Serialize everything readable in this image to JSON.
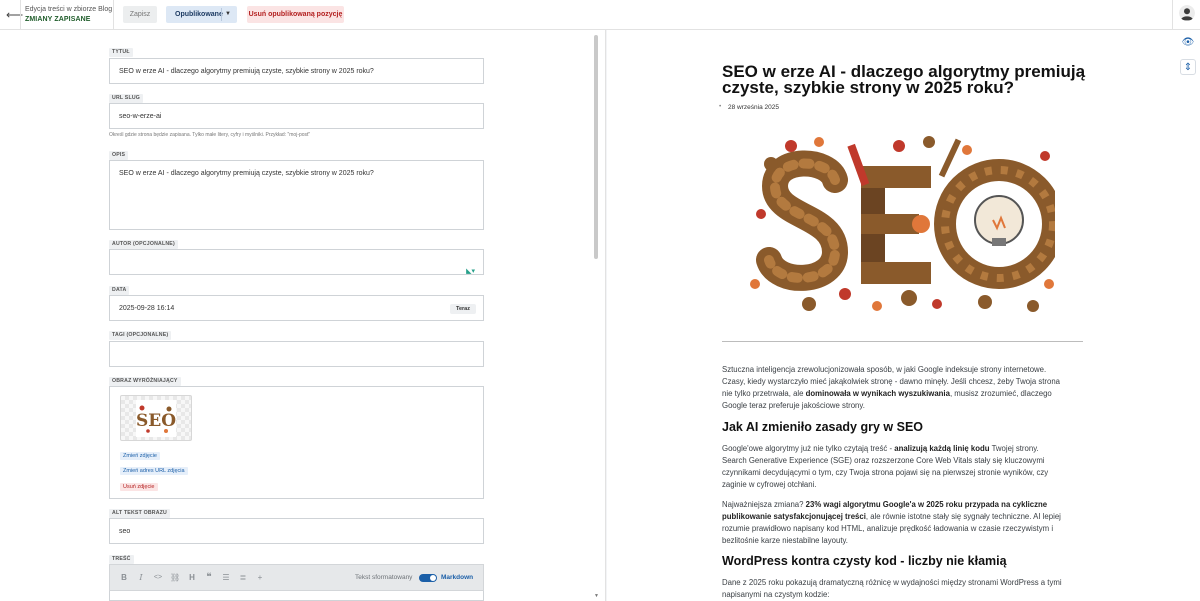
{
  "topbar": {
    "breadcrumb": "Edycja treści w zbiorze Blog",
    "status": "ZMIANY ZAPISANE",
    "save_label": "Zapisz",
    "publish_label": "Opublikowane",
    "unpublish_label": "Usuń opublikowaną pozycję"
  },
  "form": {
    "title_label": "TYTUŁ",
    "title_value": "SEO w erze AI - dlaczego algorytmy premiują czyste, szybkie strony w 2025 roku?",
    "slug_label": "URL SLUG",
    "slug_value": "seo-w-erze-ai",
    "slug_hint": "Określ gdzie strona będzie zapisana. Tylko małe litery, cyfry i myślniki. Przykład: \"moj-post\"",
    "desc_label": "OPIS",
    "desc_value": "SEO w erze AI - dlaczego algorytmy premiują czyste, szybkie strony w 2025 roku?",
    "author_label": "AUTOR (OPCJONALNE)",
    "date_label": "DATA",
    "date_value": "2025-09-28 16:14",
    "now_label": "Teraz",
    "tags_label": "TAGI (OPCJONALNE)",
    "image_label": "OBRAZ WYRÓŻNIAJĄCY",
    "change_image": "Zmień zdjęcie",
    "change_image_url": "Zmień adres URL zdjęcia",
    "remove_image": "Usuń zdjęcie",
    "alt_label": "ALT TEKST OBRAZU",
    "alt_value": "seo",
    "content_label": "TREŚĆ",
    "formatted_text_label": "Tekst sformatowany",
    "markdown_label": "Markdown"
  },
  "preview": {
    "title": "SEO w erze AI - dlaczego algorytmy premiują czyste, szybkie strony w 2025 roku?",
    "date": "28 września 2025",
    "p1_a": "Sztuczna inteligencja zrewolucjonizowała sposób, w jaki Google indeksuje strony internetowe. Czasy, kiedy wystarczyło mieć jakąkolwiek stronę - dawno minęły. Jeśli chcesz, żeby Twoja strona nie tylko przetrwała, ale ",
    "p1_b": "dominowała w wynikach wyszukiwania",
    "p1_c": ", musisz zrozumieć, dlaczego Google teraz preferuje jakościowe strony.",
    "h2_1": "Jak AI zmieniło zasady gry w SEO",
    "p2_a": "Google'owe algorytmy już nie tylko czytają treść - ",
    "p2_b": "analizują każdą linię kodu",
    "p2_c": " Twojej strony. Search Generative Experience (SGE) oraz rozszerzone Core Web Vitals stały się kluczowymi czynnikami decydującymi o tym, czy Twoja strona pojawi się na pierwszej stronie wyników, czy zaginie w cyfrowej otchłani.",
    "p3_a": "Najważniejsza zmiana? ",
    "p3_b": "23% wagi algorytmu Google'a w 2025 roku przypada na cykliczne publikowanie satysfakcjonującej treści",
    "p3_c": ", ale równie istotne stały się sygnały techniczne. AI lepiej rozumie prawidłowo napisany kod HTML, analizuje prędkość ładowania w czasie rzeczywistym i bezlitośnie karze niestabilne layouty.",
    "h2_2": "WordPress kontra czysty kod - liczby nie kłamią",
    "p4": "Dane z 2025 roku pokazują dramatyczną różnicę w wydajności między stronami WordPress a tymi napisanymi na czystym kodzie:"
  },
  "icons": {
    "back": "arrow-left-icon",
    "preview_toggle": "eye-icon",
    "sync_scroll": "vertical-arrows-icon"
  },
  "colors": {
    "accent": "#1b5fa8",
    "danger": "#b31f1f",
    "saved": "#1f5c2a",
    "seo_brown": "#8a5a2b",
    "seo_orange": "#e0773a"
  }
}
